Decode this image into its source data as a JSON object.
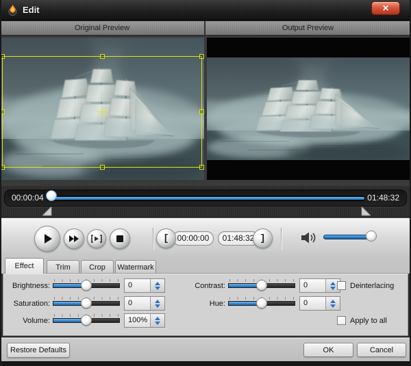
{
  "window": {
    "title": "Edit",
    "close_glyph": "✕"
  },
  "previews": {
    "original": "Original Preview",
    "output": "Output Preview"
  },
  "timeline": {
    "current": "00:00:04",
    "total": "01:48:32"
  },
  "transport": {
    "start_time": "00:00:00",
    "end_time": "01:48:32",
    "bracket_open": "[",
    "bracket_close": "]"
  },
  "tabs": [
    {
      "label": "Effect"
    },
    {
      "label": "Trim"
    },
    {
      "label": "Crop"
    },
    {
      "label": "Watermark"
    }
  ],
  "effect": {
    "rows": [
      {
        "label": "Brightness:",
        "value": "0"
      },
      {
        "label": "Saturation:",
        "value": "0"
      },
      {
        "label": "Volume:",
        "value": "100%"
      },
      {
        "label": "Contrast:",
        "value": "0"
      },
      {
        "label": "Hue:",
        "value": "0"
      }
    ],
    "checkboxes": [
      {
        "label": "Deinterlacing",
        "checked": false
      },
      {
        "label": "Apply to all",
        "checked": false
      }
    ]
  },
  "footer": {
    "restore": "Restore Defaults",
    "ok": "OK",
    "cancel": "Cancel"
  },
  "colors": {
    "accent_blue": "#1b6cb8",
    "crop_yellow": "#e2e20c",
    "close_red": "#c4462e",
    "titlebar_dark": "#1f1f1f"
  }
}
